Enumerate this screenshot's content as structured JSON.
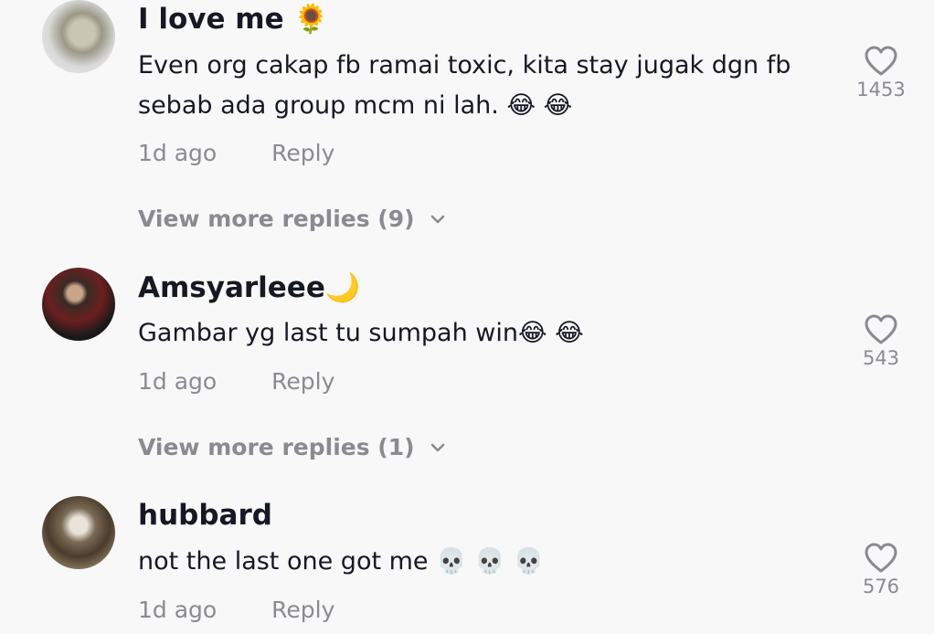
{
  "comments": [
    {
      "username": "I love me",
      "username_emoji": "🌻",
      "text": "Even org cakap fb ramai toxic, kita stay jugak dgn fb sebab ada group mcm ni lah. 😂 😂",
      "time": "1d ago",
      "reply_label": "Reply",
      "view_more": "View more replies (9)",
      "likes": "1453"
    },
    {
      "username": "Amsyarleee",
      "username_emoji": "🌙",
      "text": "Gambar yg last tu sumpah win😂 😂",
      "time": "1d ago",
      "reply_label": "Reply",
      "view_more": "View more replies (1)",
      "likes": "543"
    },
    {
      "username": "hubbard",
      "username_emoji": "",
      "text": "not the last one got me 💀 💀 💀",
      "time": "1d ago",
      "reply_label": "Reply",
      "likes": "576"
    }
  ],
  "icons": {
    "like": "heart-outline-icon",
    "expand": "chevron-down-icon"
  },
  "colors": {
    "background": "#f8f8f8",
    "username": "#161823",
    "secondary": "#8a8b91"
  }
}
